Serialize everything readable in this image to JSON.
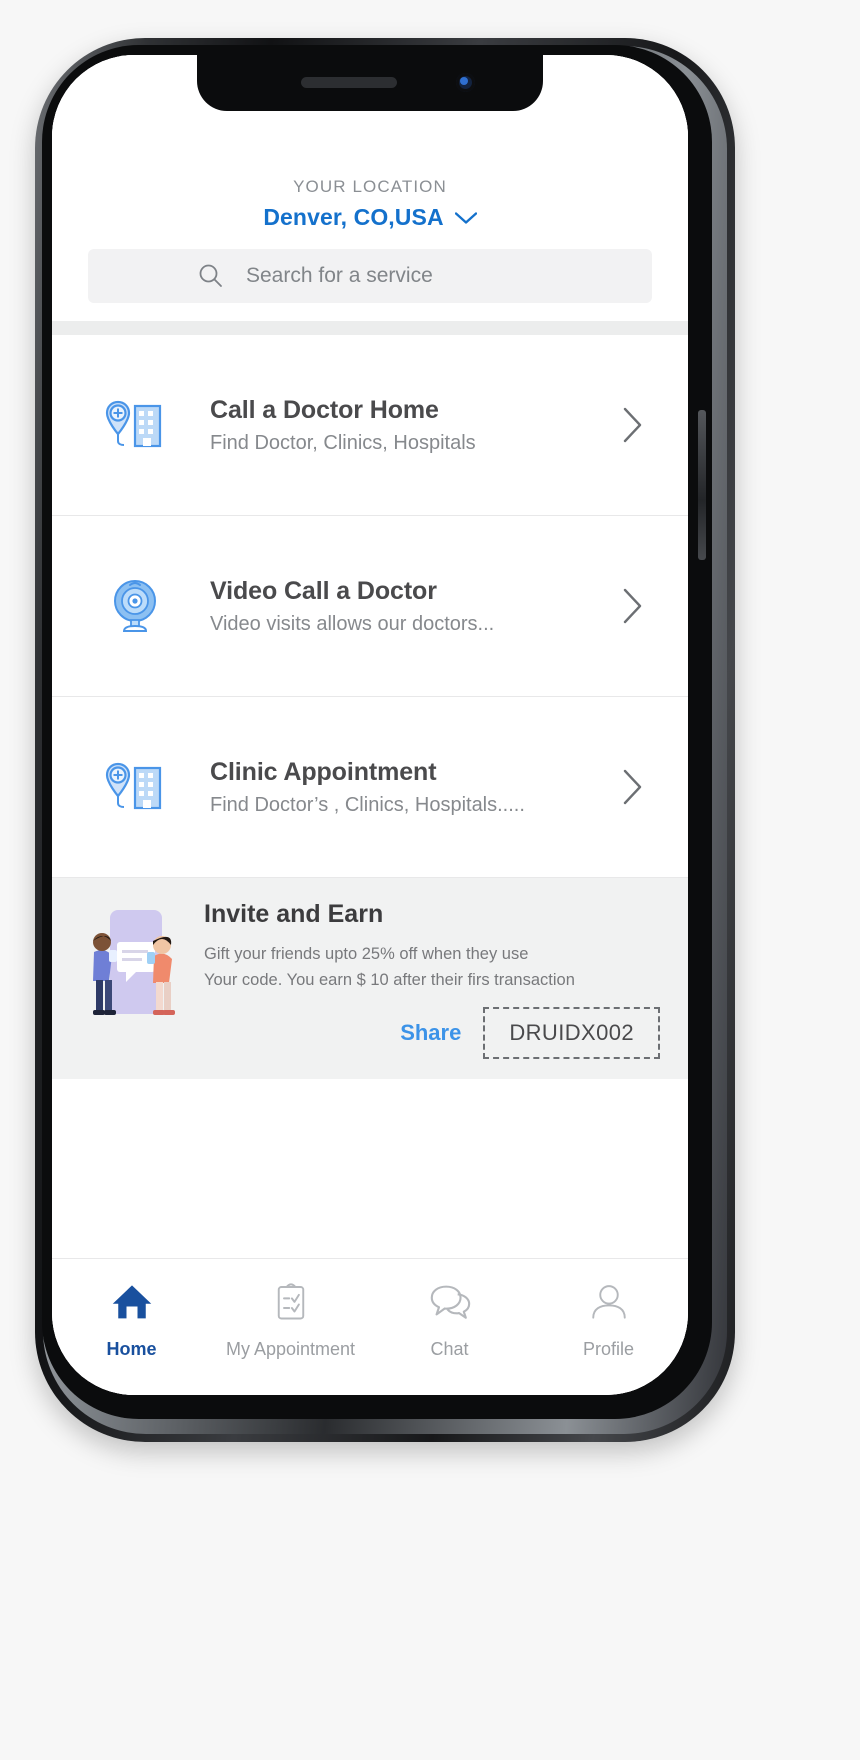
{
  "header": {
    "location_label": "YOUR LOCATION",
    "location_value": "Denver, CO,USA",
    "chevron_icon": "chevron-down-icon"
  },
  "search": {
    "placeholder": "Search for a service",
    "value": "",
    "icon": "search-icon"
  },
  "services": [
    {
      "title": "Call a Doctor Home",
      "subtitle": "Find Doctor, Clinics, Hospitals",
      "icon": "hospital-location-pin-icon",
      "chevron": "chevron-right-icon"
    },
    {
      "title": "Video Call a Doctor",
      "subtitle": "Video visits allows our doctors...",
      "icon": "webcam-icon",
      "chevron": "chevron-right-icon"
    },
    {
      "title": "Clinic Appointment",
      "subtitle": "Find Doctor’s , Clinics, Hospitals.....",
      "icon": "hospital-location-pin-icon",
      "chevron": "chevron-right-icon"
    }
  ],
  "invite": {
    "title": "Invite and Earn",
    "line1": "Gift your friends upto 25% off when they use",
    "line2": "Your code. You earn $ 10 after their firs transaction",
    "share_label": "Share",
    "promo_code": "DRUIDX002",
    "illustration": "invite-friends-illustration"
  },
  "tabs": [
    {
      "label": "Home",
      "icon": "home-icon",
      "active": true
    },
    {
      "label": "My Appointment",
      "icon": "clipboard-checklist-icon",
      "active": false
    },
    {
      "label": "Chat",
      "icon": "chat-bubbles-icon",
      "active": false
    },
    {
      "label": "Profile",
      "icon": "user-profile-icon",
      "active": false
    }
  ],
  "colors": {
    "accent_blue": "#1471cc",
    "active_tab_blue": "#19509e",
    "share_blue": "#3c93e8",
    "icon_blue": "#5a9de8",
    "title_gray": "#4a4a4c",
    "subtitle_gray": "#86898d",
    "banner_bg": "#f1f2f2",
    "search_bg": "#f2f2f3"
  }
}
